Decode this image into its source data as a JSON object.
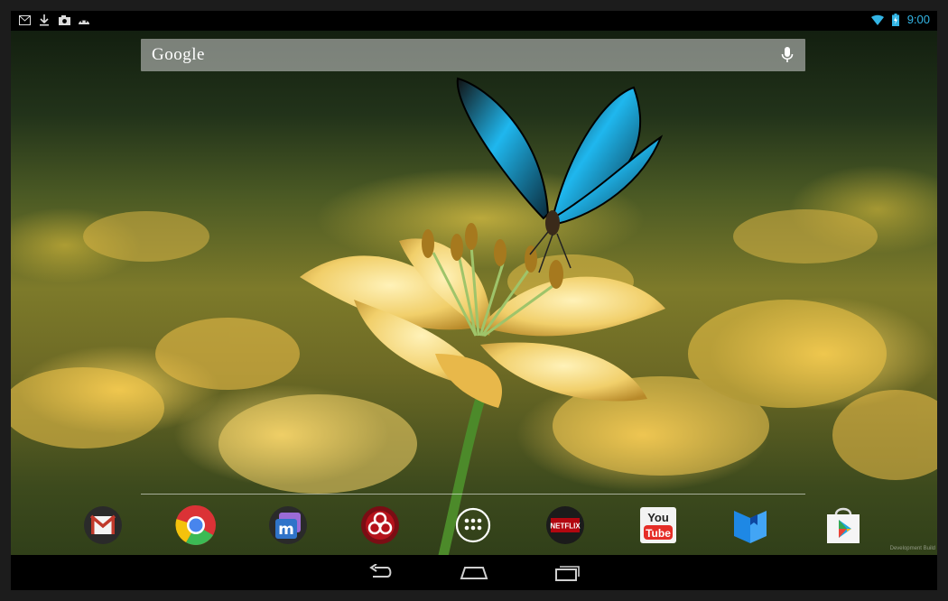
{
  "status_bar": {
    "notifications": [
      "gmail-icon",
      "download-icon",
      "camera-icon",
      "android-icon"
    ],
    "system": [
      "wifi-icon",
      "battery-charging-icon"
    ],
    "time": "9:00"
  },
  "search": {
    "logo_text": "Google",
    "mic_icon": "microphone-icon"
  },
  "dock": {
    "apps": [
      {
        "name": "Gmail",
        "icon": "gmail-icon"
      },
      {
        "name": "Chrome",
        "icon": "chrome-icon"
      },
      {
        "name": "Messenger",
        "icon": "messenger-icon"
      },
      {
        "name": "Plague",
        "icon": "biohazard-icon"
      },
      {
        "name": "All Apps",
        "icon": "app-drawer-icon"
      },
      {
        "name": "Netflix",
        "icon": "netflix-icon",
        "label": "NETFLIX"
      },
      {
        "name": "YouTube",
        "icon": "youtube-icon",
        "label_top": "You",
        "label_bottom": "Tube"
      },
      {
        "name": "Play Books",
        "icon": "play-books-icon"
      },
      {
        "name": "Play Store",
        "icon": "play-store-icon"
      }
    ]
  },
  "nav_bar": {
    "buttons": [
      "back-icon",
      "home-icon",
      "recent-apps-icon"
    ]
  },
  "watermark": "Development Build",
  "colors": {
    "accent": "#33b5e5",
    "status_bar": "#000000",
    "nav_bar": "#000000"
  }
}
